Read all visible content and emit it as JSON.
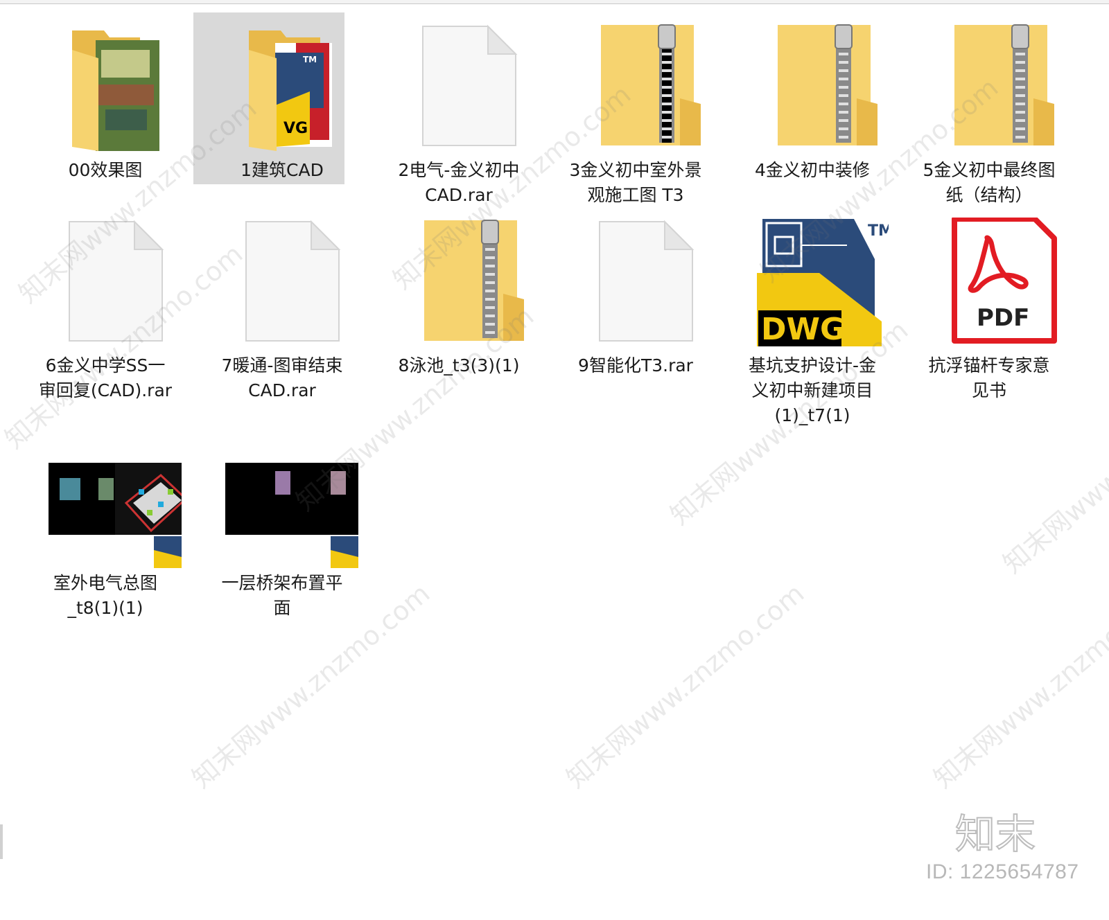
{
  "items": [
    {
      "label": "00效果图"
    },
    {
      "label": "1建筑CAD"
    },
    {
      "label": "2电气-金义初中\nCAD.rar"
    },
    {
      "label": "3金义初中室外景\n观施工图 T3"
    },
    {
      "label": "4金义初中装修"
    },
    {
      "label": "5金义初中最终图\n纸（结构）"
    },
    {
      "label": "6金义中学SS一\n审回复(CAD).rar"
    },
    {
      "label": "7暖通-图审结束\nCAD.rar"
    },
    {
      "label": "8泳池_t3(3)(1)"
    },
    {
      "label": "9智能化T3.rar"
    },
    {
      "label": "基坑支护设计-金\n义初中新建项目\n(1)_t7(1)"
    },
    {
      "label": "抗浮锚杆专家意\n见书"
    },
    {
      "label": "室外电气总图\n_t8(1)(1)"
    },
    {
      "label": "一层桥架布置平\n面"
    }
  ],
  "icons": {
    "pdf_text": "PDF",
    "dwg_text": "DWG",
    "tm_text": "TM"
  },
  "watermark": {
    "text": "知末网www.znzmo.com",
    "brand": "知末",
    "id_text": "ID: 1225654787"
  },
  "colors": {
    "folder": "#f6d36f",
    "folder_dark": "#e8b94a",
    "pdf_red": "#e21c23",
    "dwg_yellow": "#f2c811",
    "dwg_blue": "#2b4b7a",
    "selection": "#d9d9d9"
  }
}
